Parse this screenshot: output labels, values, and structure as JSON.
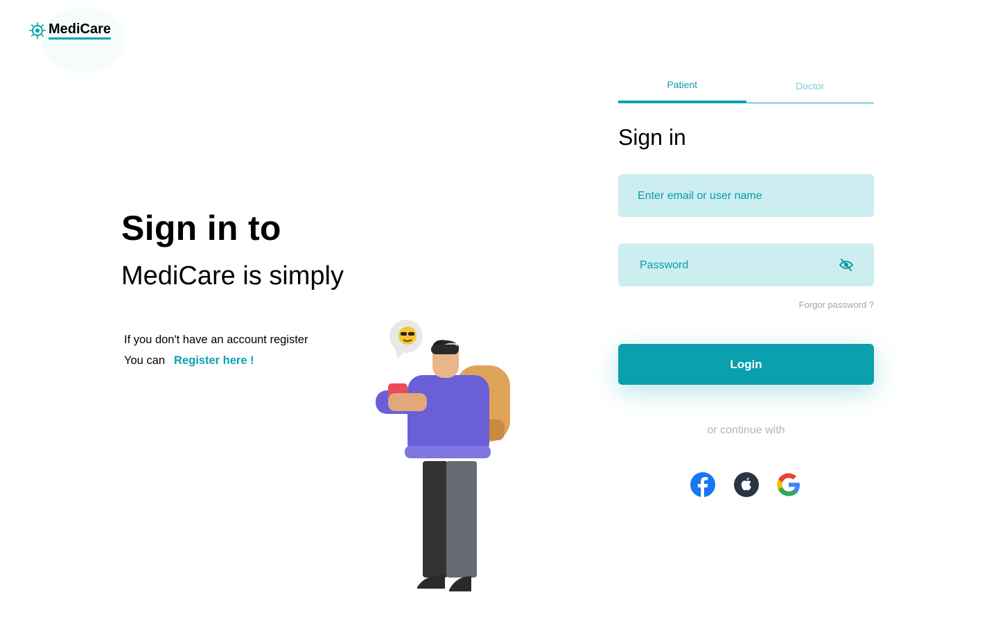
{
  "brand": {
    "name": "MediCare"
  },
  "hero": {
    "headline": "Sign in to",
    "subhead": "MediCare is simply",
    "info_line": "If you don't have an account register",
    "info_prefix": "You can",
    "register_link": "Register here !"
  },
  "tabs": [
    {
      "label": "Patient",
      "active": true
    },
    {
      "label": "Doctor",
      "active": false
    }
  ],
  "form": {
    "title": "Sign in",
    "email_placeholder": "Enter email or user name",
    "password_placeholder": "Password",
    "forgot_label": "Forgor password ?",
    "login_label": "Login",
    "or_text": "or continue with"
  },
  "social": [
    "facebook-icon",
    "apple-icon",
    "google-icon"
  ],
  "colors": {
    "accent": "#0aa3b0",
    "field_bg": "#cdeef0",
    "muted": "#a4a4a4"
  }
}
